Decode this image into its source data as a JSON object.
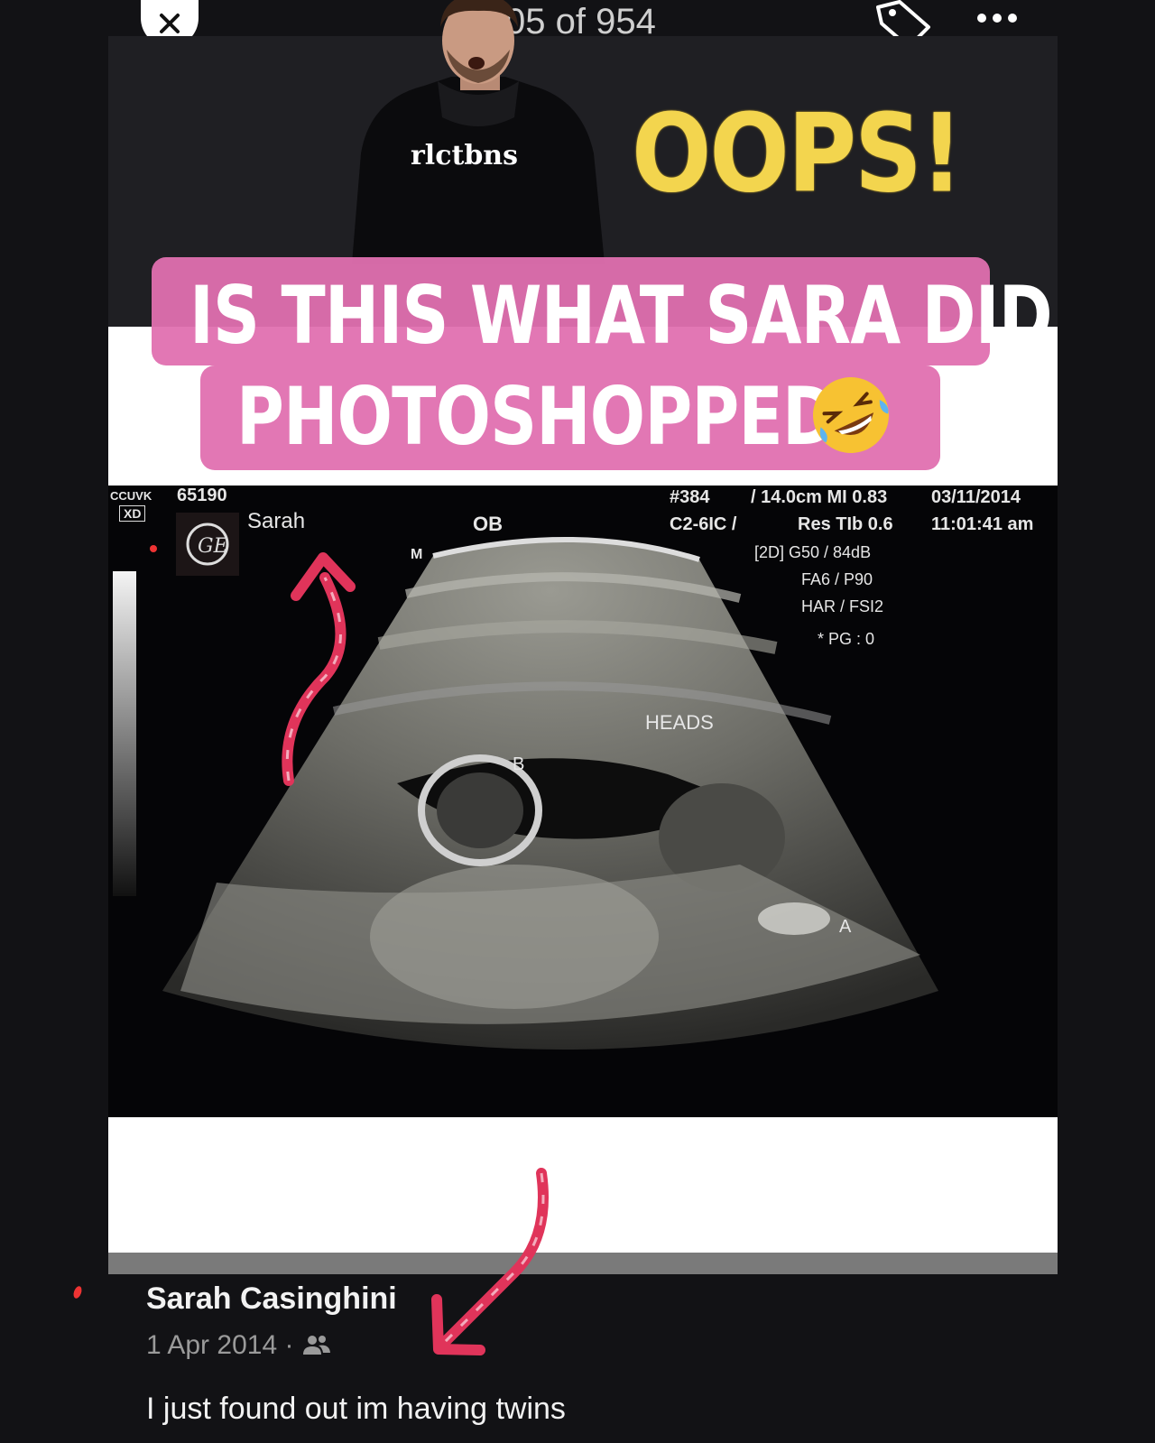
{
  "viewer": {
    "counter": "05 of 954",
    "close_icon": "close-icon",
    "tag_icon": "tag-icon",
    "more_icon": "more-options-icon"
  },
  "sticker": {
    "shirt_text": "rlctbns",
    "oops": "OOPS!"
  },
  "caption": {
    "line1": "IS THIS WHAT SARA DID",
    "line2": "PHOTOSHOPPED?",
    "emoji": "rolling-on-floor-laughing-emoji"
  },
  "ultrasound": {
    "brand": "CCUVK",
    "id": "65190",
    "xd": "XD",
    "patient": "Sarah",
    "mode": "OB",
    "marker_m": "M",
    "frame": "#384",
    "probe": "C2-6IC /",
    "depth": "/ 14.0cm MI 0.83",
    "res": "Res TIb 0.6",
    "date": "03/11/2014",
    "time": "11:01:41 am",
    "params": [
      "[2D] G50 / 84dB",
      "FA6 / P90",
      "HAR / FSI2",
      "* PG : 0"
    ],
    "label_heads": "HEADS",
    "label_b": "B",
    "label_a": "A"
  },
  "post": {
    "author": "Sarah Casinghini",
    "date": "1 Apr 2014 ·",
    "audience_icon": "friends-icon",
    "text": "I just found out im having twins"
  },
  "colors": {
    "background": "#121215",
    "caption_bg": "#e070b0",
    "oops": "#f3d54e",
    "arrow": "#e0345a"
  }
}
